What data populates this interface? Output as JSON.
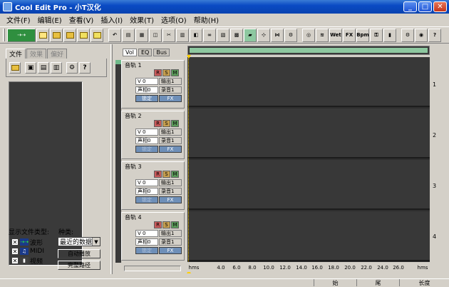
{
  "window": {
    "title": "Cool Edit Pro  - 小T汉化"
  },
  "menu": [
    "文件(F)",
    "编辑(E)",
    "查看(V)",
    "插入(I)",
    "效果(T)",
    "选项(O)",
    "帮助(H)"
  ],
  "toolbar_labels": {
    "wet": "Wet",
    "fx": "FX",
    "bpm": "Bpm"
  },
  "left_panel": {
    "tabs": [
      "文件",
      "效果",
      "偏好"
    ],
    "filetype_label": "显示文件类型:",
    "kind_label": "种类:",
    "filetypes": [
      {
        "checked": "✕",
        "icon": "wave-icon",
        "label": "波形"
      },
      {
        "checked": "✕",
        "icon": "midi-icon",
        "label": "MIDI"
      },
      {
        "checked": "✕",
        "icon": "video-icon",
        "label": "视频"
      }
    ],
    "kind_value": "最近的数据",
    "auto_play_label": "自动播放",
    "full_path_label": "完整路径"
  },
  "track_view_tabs": [
    "Vol",
    "EQ",
    "Bus"
  ],
  "tracks": [
    {
      "name": "音轨 1",
      "vol": "V 0",
      "pan": "声相0",
      "out": "输出1",
      "in": "录音1",
      "lock": "锁定",
      "fx": "FX",
      "lane": "1"
    },
    {
      "name": "音轨 2",
      "vol": "V 0",
      "pan": "声相0",
      "out": "输出1",
      "in": "录音1",
      "lock": "锁定",
      "fx": "FX",
      "lane": "2"
    },
    {
      "name": "音轨 3",
      "vol": "V 0",
      "pan": "声相0",
      "out": "输出1",
      "in": "录音1",
      "lock": "锁定",
      "fx": "FX",
      "lane": "3"
    },
    {
      "name": "音轨 4",
      "vol": "V 0",
      "pan": "声相0",
      "out": "输出1",
      "in": "录音1",
      "lock": "锁定",
      "fx": "FX",
      "lane": "4"
    }
  ],
  "rsm": {
    "r": "R",
    "s": "S",
    "m": "M"
  },
  "ruler": {
    "unit_left": "hms",
    "unit_right": "hms",
    "ticks": [
      "4.0",
      "6.0",
      "8.0",
      "10.0",
      "12.0",
      "14.0",
      "16.0",
      "18.0",
      "20.0",
      "22.0",
      "24.0",
      "26.0"
    ]
  },
  "status": {
    "begin": "始",
    "end": "尾",
    "length": "长度"
  },
  "colors": {
    "titlebar": "#0a4bc4",
    "wave_bg": "#383838",
    "playhead": "#ffd000",
    "overview": "#8ec8a0"
  }
}
